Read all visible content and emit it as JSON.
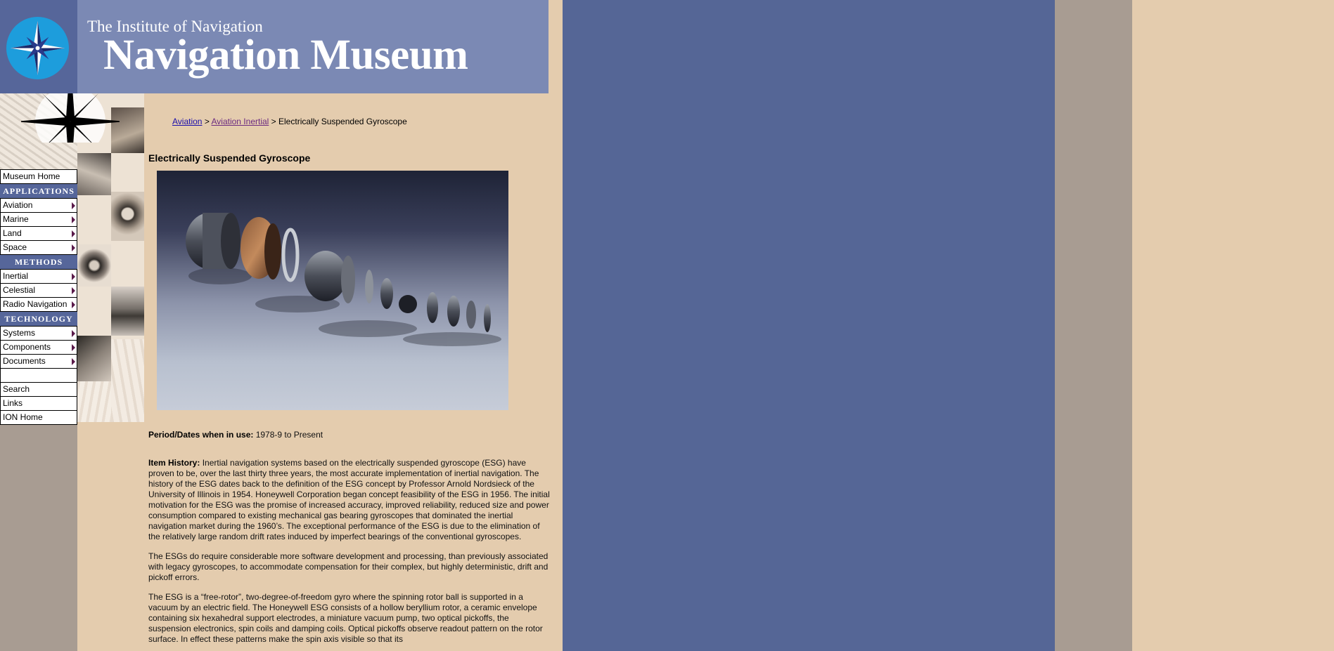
{
  "header": {
    "subtitle": "The Institute of Navigation",
    "title": "Navigation Museum"
  },
  "nav": {
    "items": [
      {
        "type": "link",
        "label": "Museum Home",
        "arrow": false
      },
      {
        "type": "heading",
        "label": "APPLICATIONS"
      },
      {
        "type": "link",
        "label": "Aviation",
        "arrow": true
      },
      {
        "type": "link",
        "label": "Marine",
        "arrow": true
      },
      {
        "type": "link",
        "label": "Land",
        "arrow": true
      },
      {
        "type": "link",
        "label": "Space",
        "arrow": true
      },
      {
        "type": "heading",
        "label": "METHODS"
      },
      {
        "type": "link",
        "label": "Inertial",
        "arrow": true
      },
      {
        "type": "link",
        "label": "Celestial",
        "arrow": true
      },
      {
        "type": "link",
        "label": "Radio Navigation",
        "arrow": true
      },
      {
        "type": "heading",
        "label": "TECHNOLOGY"
      },
      {
        "type": "link",
        "label": "Systems",
        "arrow": true
      },
      {
        "type": "link",
        "label": "Components",
        "arrow": true
      },
      {
        "type": "link",
        "label": "Documents",
        "arrow": true
      },
      {
        "type": "blank",
        "label": ""
      },
      {
        "type": "link",
        "label": "Search",
        "arrow": false
      },
      {
        "type": "link",
        "label": "Links",
        "arrow": false
      },
      {
        "type": "link",
        "label": "ION Home",
        "arrow": false
      }
    ]
  },
  "breadcrumb": {
    "crumb1": "Aviation",
    "sep1": " > ",
    "crumb2": "Aviation Inertial",
    "sep2": " > ",
    "current": "Electrically Suspended Gyroscope"
  },
  "page": {
    "title": "Electrically Suspended Gyroscope"
  },
  "details": {
    "period_label": "Period/Dates when in use:",
    "period_value": " 1978-9 to Present",
    "history_label": "Item History:",
    "history_text": " Inertial navigation systems based on the electrically suspended gyroscope (ESG) have proven to be, over the last thirty three years, the most accurate implementation of inertial navigation. The history of the ESG dates back to the definition of the ESG concept by Professor Arnold Nordsieck of the University of Illinois in 1954. Honeywell Corporation began concept feasibility of the ESG in 1956. The initial motivation for the ESG was the promise of increased accuracy, improved reliability, reduced size and power consumption compared to existing mechanical gas bearing gyroscopes that dominated the inertial navigation market during the 1960’s. The exceptional performance of the ESG is due to the elimination of the relatively large random drift rates induced by imperfect bearings of the conventional gyroscopes.",
    "para2": "The ESGs do require considerable more software development and processing, than previously associated with legacy gyroscopes, to accommodate compensation for their complex, but highly deterministic, drift and pickoff errors.",
    "para3": "The ESG is a “free-rotor”, two-degree-of-freedom gyro where the spinning rotor ball is supported in a vacuum by an electric field. The Honeywell ESG consists of a hollow beryllium rotor, a ceramic envelope containing six hexahedral support electrodes, a miniature vacuum pump, two optical pickoffs, the suspension electronics, spin coils and damping coils. Optical pickoffs observe readout pattern on the rotor surface. In effect these patterns make the spin axis visible so that its"
  }
}
